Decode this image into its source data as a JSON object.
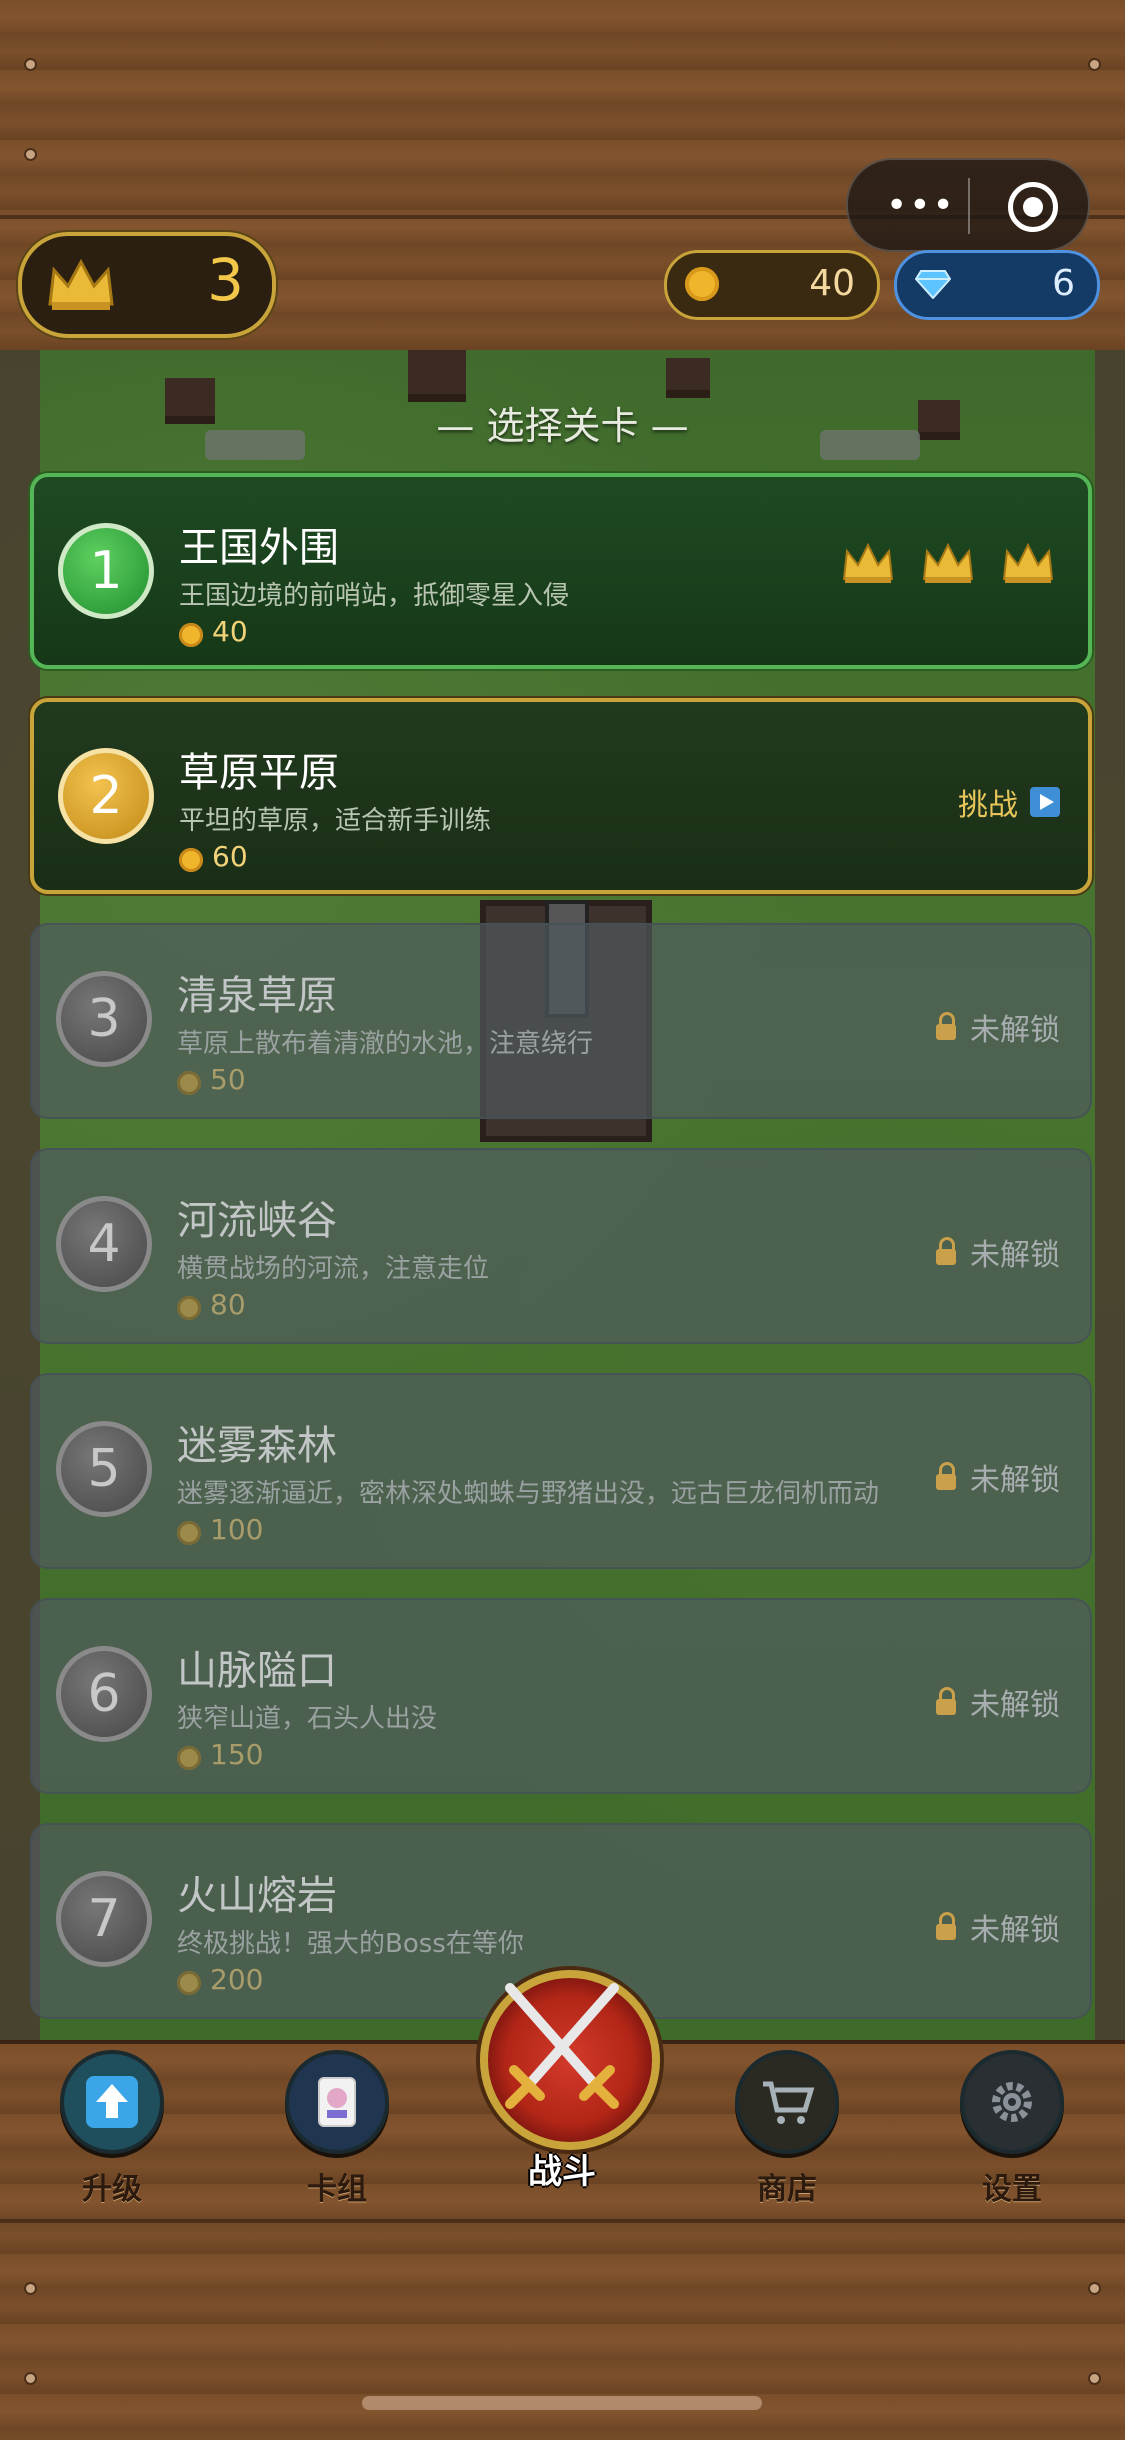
{
  "header": {
    "crowns": "3",
    "gold": "40",
    "gems": "6",
    "menu_dots": "•••"
  },
  "section_title": "— 选择关卡 —",
  "levels": [
    {
      "num": "1",
      "name": "王国外围",
      "desc": "王国边境的前哨站，抵御零星入侵",
      "reward": "40",
      "status": "done",
      "crowns_earned": 3
    },
    {
      "num": "2",
      "name": "草原平原",
      "desc": "平坦的草原，适合新手训练",
      "reward": "60",
      "status": "current",
      "action": "挑战"
    },
    {
      "num": "3",
      "name": "清泉草原",
      "desc": "草原上散布着清澈的水池，注意绕行",
      "reward": "50",
      "status": "locked",
      "lock_text": "未解锁"
    },
    {
      "num": "4",
      "name": "河流峡谷",
      "desc": "横贯战场的河流，注意走位",
      "reward": "80",
      "status": "locked",
      "lock_text": "未解锁"
    },
    {
      "num": "5",
      "name": "迷雾森林",
      "desc": "迷雾逐渐逼近，密林深处蜘蛛与野猪出没，远古巨龙伺机而动",
      "reward": "100",
      "status": "locked",
      "lock_text": "未解锁"
    },
    {
      "num": "6",
      "name": "山脉隘口",
      "desc": "狭窄山道，石头人出没",
      "reward": "150",
      "status": "locked",
      "lock_text": "未解锁"
    },
    {
      "num": "7",
      "name": "火山熔岩",
      "desc": "终极挑战！强大的Boss在等你",
      "reward": "200",
      "status": "locked",
      "lock_text": "未解锁"
    }
  ],
  "nav": {
    "upgrade": "升级",
    "deck": "卡组",
    "battle": "战斗",
    "shop": "商店",
    "settings": "设置"
  },
  "colors": {
    "gold_accent": "#c9a43a",
    "completed_green": "#55b657",
    "locked_gray": "#50595f"
  }
}
